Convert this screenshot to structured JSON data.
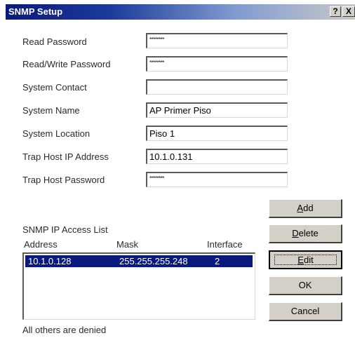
{
  "window": {
    "title": "SNMP Setup",
    "help_glyph": "?",
    "close_glyph": "X"
  },
  "fields": [
    {
      "label": "Read Password",
      "value": "********",
      "masked": true
    },
    {
      "label": "Read/Write Password",
      "value": "********",
      "masked": true
    },
    {
      "label": "System Contact",
      "value": "",
      "masked": false
    },
    {
      "label": "System Name",
      "value": "AP Primer Piso",
      "masked": false
    },
    {
      "label": "System Location",
      "value": "Piso 1",
      "masked": false
    },
    {
      "label": "Trap Host IP Address",
      "value": "10.1.0.131",
      "masked": false
    },
    {
      "label": "Trap Host Password",
      "value": "********",
      "masked": true
    }
  ],
  "access_list": {
    "title": "SNMP IP Access List",
    "columns": [
      "Address",
      "Mask",
      "Interface"
    ],
    "rows": [
      {
        "address": "10.1.0.128",
        "mask": "255.255.255.248",
        "interface": "2",
        "selected": true
      }
    ],
    "footer": "All others are denied"
  },
  "buttons": {
    "add": {
      "pre": "",
      "mnemonic": "A",
      "post": "dd"
    },
    "delete": {
      "pre": "",
      "mnemonic": "D",
      "post": "elete"
    },
    "edit": {
      "pre": "",
      "mnemonic": "E",
      "post": "dit"
    },
    "ok": "OK",
    "cancel": "Cancel"
  },
  "colors": {
    "title_bar_start": "#0a1a7c",
    "selection": "#0a1a7c",
    "button_face": "#d4d0c8"
  }
}
